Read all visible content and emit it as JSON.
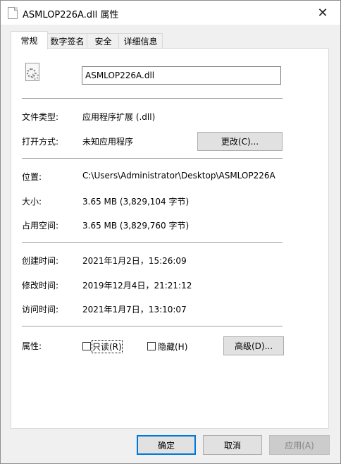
{
  "window": {
    "title": "ASMLOP226A.dll 属性",
    "close_glyph": "✕"
  },
  "tabs": [
    {
      "label": "常规",
      "active": true
    },
    {
      "label": "数字签名",
      "active": false
    },
    {
      "label": "安全",
      "active": false
    },
    {
      "label": "详细信息",
      "active": false
    }
  ],
  "general": {
    "file_name": "ASMLOP226A.dll",
    "file_type_label": "文件类型:",
    "file_type_value": "应用程序扩展 (.dll)",
    "opens_with_label": "打开方式:",
    "opens_with_value": "未知应用程序",
    "change_button": "更改(C)...",
    "location_label": "位置:",
    "location_value": "C:\\Users\\Administrator\\Desktop\\ASMLOP226A",
    "size_label": "大小:",
    "size_value": "3.65 MB (3,829,104 字节)",
    "size_on_disk_label": "占用空间:",
    "size_on_disk_value": "3.65 MB (3,829,760 字节)",
    "created_label": "创建时间:",
    "created_value": "2021年1月2日，15:26:09",
    "modified_label": "修改时间:",
    "modified_value": "2019年12月4日，21:21:12",
    "accessed_label": "访问时间:",
    "accessed_value": "2021年1月7日，13:10:07",
    "attributes_label": "属性:",
    "readonly_label": "只读(R)",
    "readonly_checked": false,
    "hidden_label": "隐藏(H)",
    "hidden_checked": false,
    "advanced_button": "高级(D)..."
  },
  "footer": {
    "ok": "确定",
    "cancel": "取消",
    "apply": "应用(A)"
  },
  "colors": {
    "accent": "#0078d7",
    "dialog_bg": "#f0f0f0",
    "panel_bg": "#ffffff",
    "button_bg": "#e1e1e1"
  }
}
